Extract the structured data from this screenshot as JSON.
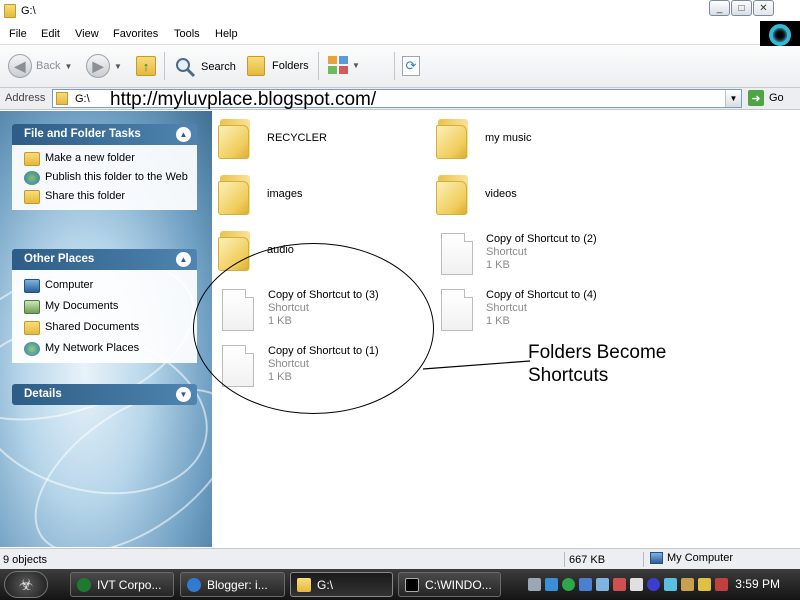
{
  "window": {
    "title": "G:\\",
    "buttons": {
      "minimize": "_",
      "maximize": "□",
      "close": "✕"
    }
  },
  "menu": [
    "File",
    "Edit",
    "View",
    "Favorites",
    "Tools",
    "Help"
  ],
  "toolbar": {
    "back_label": "Back",
    "search_label": "Search",
    "folders_label": "Folders"
  },
  "address": {
    "label": "Address",
    "path": "G:\\",
    "go_label": "Go"
  },
  "watermark": "http://myluvplace.blogspot.com/",
  "left_pane": {
    "panels": [
      {
        "title": "File and Folder Tasks",
        "items": [
          "Make a new folder",
          "Publish this folder to the Web",
          "Share this folder"
        ]
      },
      {
        "title": "Other Places",
        "items": [
          "Computer",
          "My Documents",
          "Shared Documents",
          "My Network Places"
        ]
      },
      {
        "title": "Details",
        "items": []
      }
    ]
  },
  "files": [
    {
      "name": "RECYCLER",
      "kind": "folder"
    },
    {
      "name": "my music",
      "kind": "folder"
    },
    {
      "name": "images",
      "kind": "folder"
    },
    {
      "name": "videos",
      "kind": "folder"
    },
    {
      "name": "audio",
      "kind": "folder"
    },
    {
      "name": "Copy of Shortcut to (2)",
      "kind": "shortcut",
      "type": "Shortcut",
      "size": "1 KB"
    },
    {
      "name": "Copy of Shortcut to (3)",
      "kind": "shortcut",
      "type": "Shortcut",
      "size": "1 KB"
    },
    {
      "name": "Copy of Shortcut to (4)",
      "kind": "shortcut",
      "type": "Shortcut",
      "size": "1 KB"
    },
    {
      "name": "Copy of Shortcut to (1)",
      "kind": "shortcut",
      "type": "Shortcut",
      "size": "1 KB"
    }
  ],
  "annotation": {
    "line1": "Folders Become",
    "line2": "Shortcuts"
  },
  "status": {
    "objects": "9 objects",
    "size": "667 KB",
    "location": "My Computer"
  },
  "taskbar": {
    "items": [
      "IVT Corpo...",
      "Blogger: i...",
      "G:\\",
      "C:\\WINDO..."
    ],
    "clock": "3:59 PM"
  },
  "colors": {
    "panel_header": "#2d5d86",
    "folder_yellow": "#f0cd5c",
    "taskbar": "#1c1c1c"
  }
}
